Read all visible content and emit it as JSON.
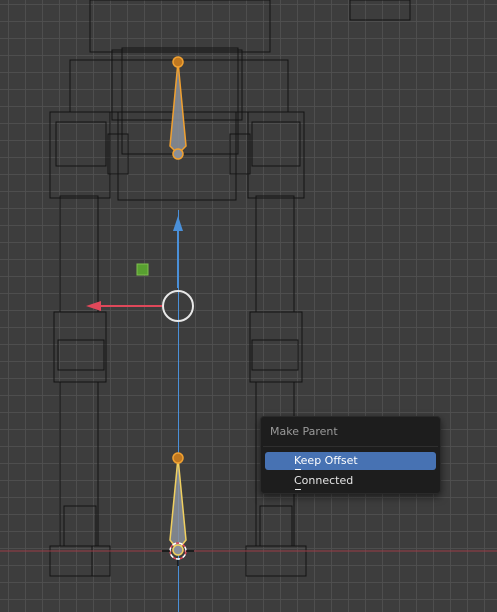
{
  "viewport": {
    "grid_color": "#505050",
    "background_color": "#3d3d3d",
    "axis_colors": {
      "x": "#e0485a",
      "y": "#4a90d9"
    },
    "bone_color": "#f0a030"
  },
  "make_parent_menu": {
    "title": "Make Parent",
    "items": [
      {
        "label": "Keep Offset",
        "highlighted": true
      },
      {
        "label": "Connected",
        "highlighted": false
      }
    ],
    "highlight_color": "#4772b3"
  }
}
